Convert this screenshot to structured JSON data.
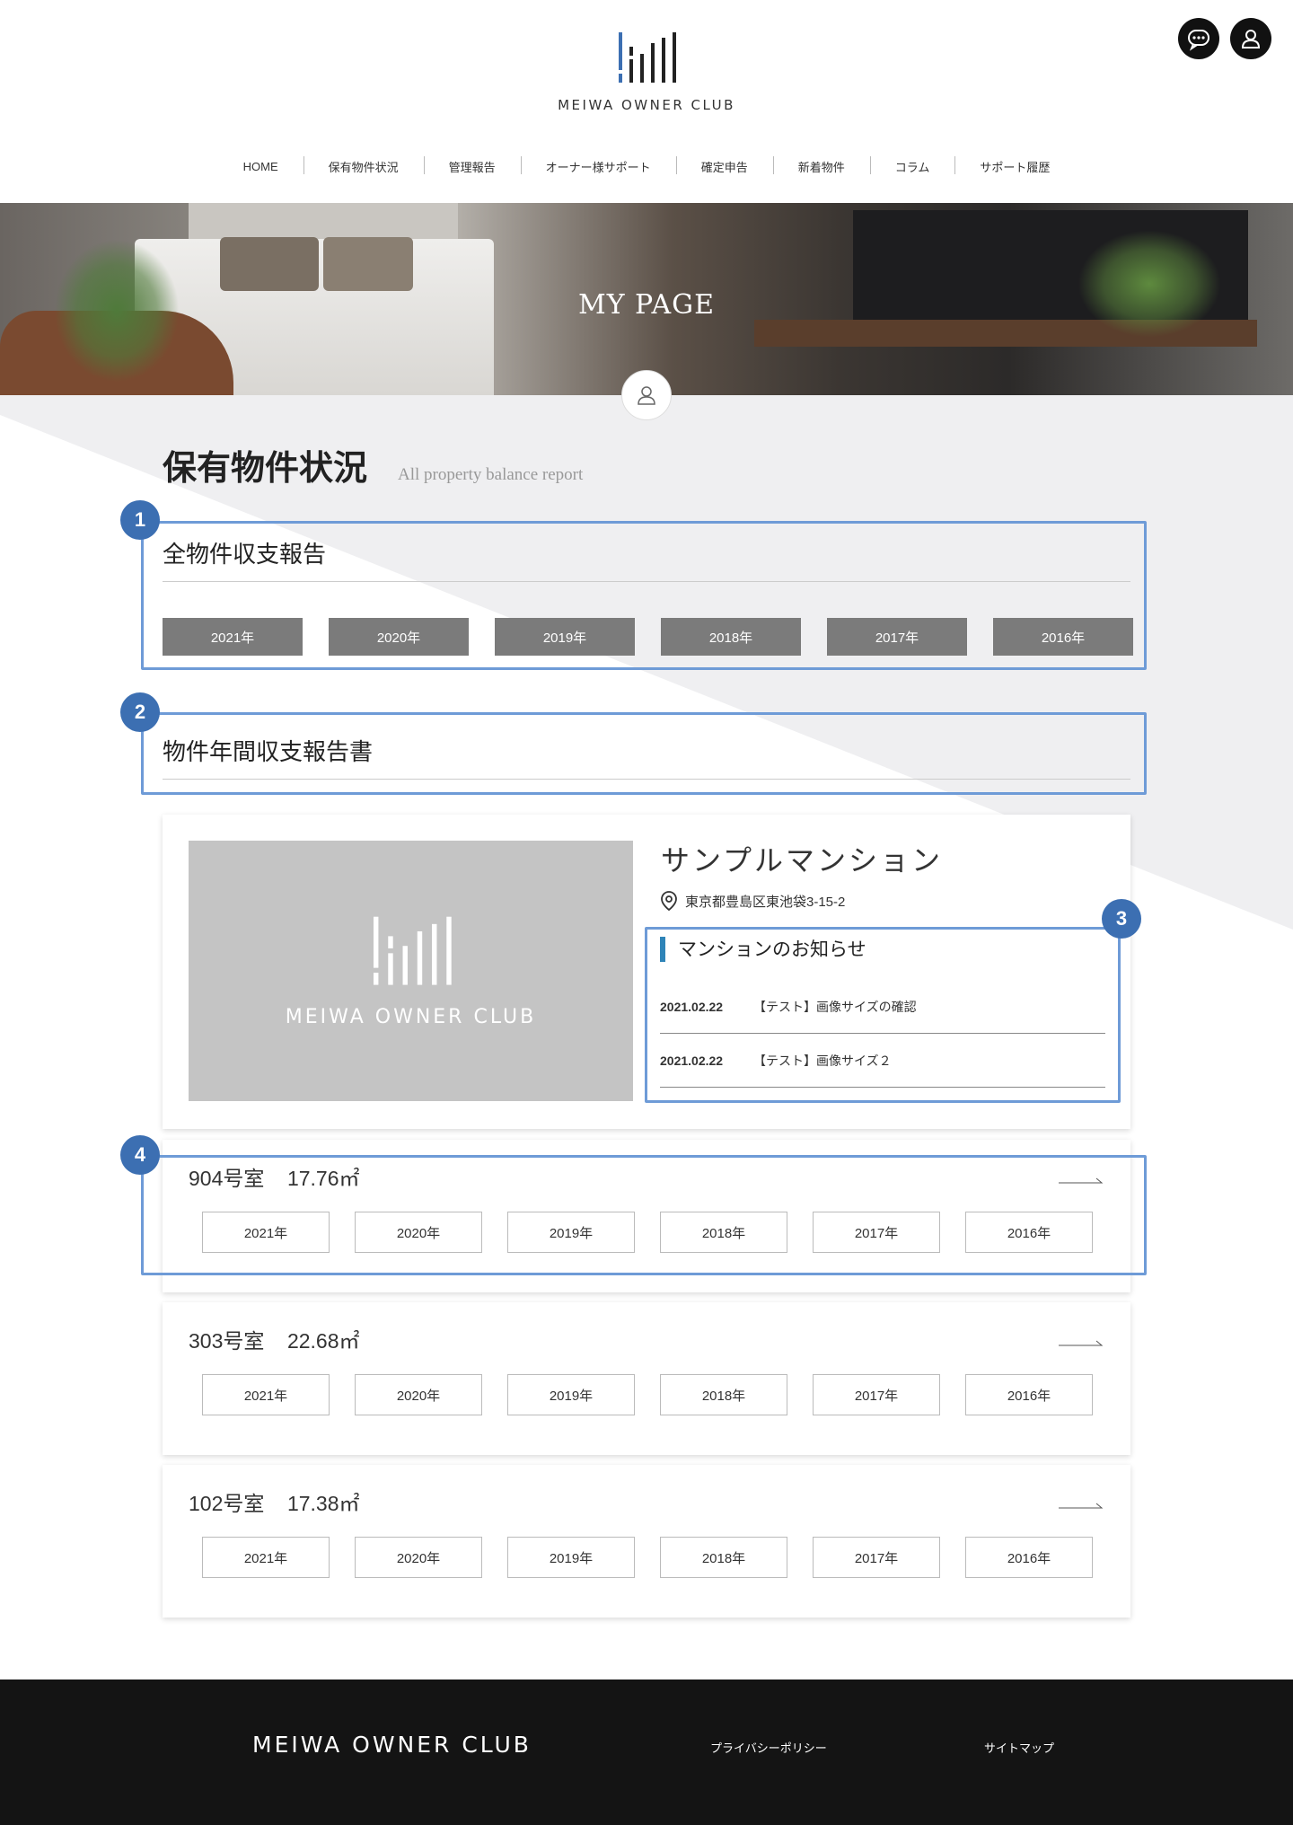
{
  "brand": {
    "name": "MEIWA OWNER CLUB"
  },
  "header": {
    "icons": [
      "chat-icon",
      "user-icon"
    ]
  },
  "nav": {
    "items": [
      "HOME",
      "保有物件状況",
      "管理報告",
      "オーナー様サポート",
      "確定申告",
      "新着物件",
      "コラム",
      "サポート履歴"
    ]
  },
  "hero": {
    "title": "MY PAGE"
  },
  "page": {
    "title": "保有物件状況",
    "subtitle": "All property balance report"
  },
  "annotation_badges": [
    "1",
    "2",
    "3",
    "4"
  ],
  "section_all": {
    "title": "全物件収支報告",
    "years": [
      "2021年",
      "2020年",
      "2019年",
      "2018年",
      "2017年",
      "2016年"
    ]
  },
  "section_annual": {
    "title": "物件年間収支報告書"
  },
  "property": {
    "name": "サンプルマンション",
    "address": "東京都豊島区東池袋3-15-2",
    "notice_title": "マンションのお知らせ",
    "notices": [
      {
        "date": "2021.02.22",
        "text": "【テスト】画像サイズの確認"
      },
      {
        "date": "2021.02.22",
        "text": "【テスト】画像サイズ２"
      }
    ]
  },
  "units": [
    {
      "room": "904号室",
      "area": "17.76㎡",
      "years": [
        "2021年",
        "2020年",
        "2019年",
        "2018年",
        "2017年",
        "2016年"
      ]
    },
    {
      "room": "303号室",
      "area": "22.68㎡",
      "years": [
        "2021年",
        "2020年",
        "2019年",
        "2018年",
        "2017年",
        "2016年"
      ]
    },
    {
      "room": "102号室",
      "area": "17.38㎡",
      "years": [
        "2021年",
        "2020年",
        "2019年",
        "2018年",
        "2017年",
        "2016年"
      ]
    }
  ],
  "footer": {
    "links": [
      "プライバシーポリシー",
      "サイトマップ"
    ]
  },
  "colors": {
    "highlight": "#6e9bd7",
    "badge": "#3c6fb2",
    "notice_accent": "#2f84b8",
    "footer_bg": "#141414"
  }
}
